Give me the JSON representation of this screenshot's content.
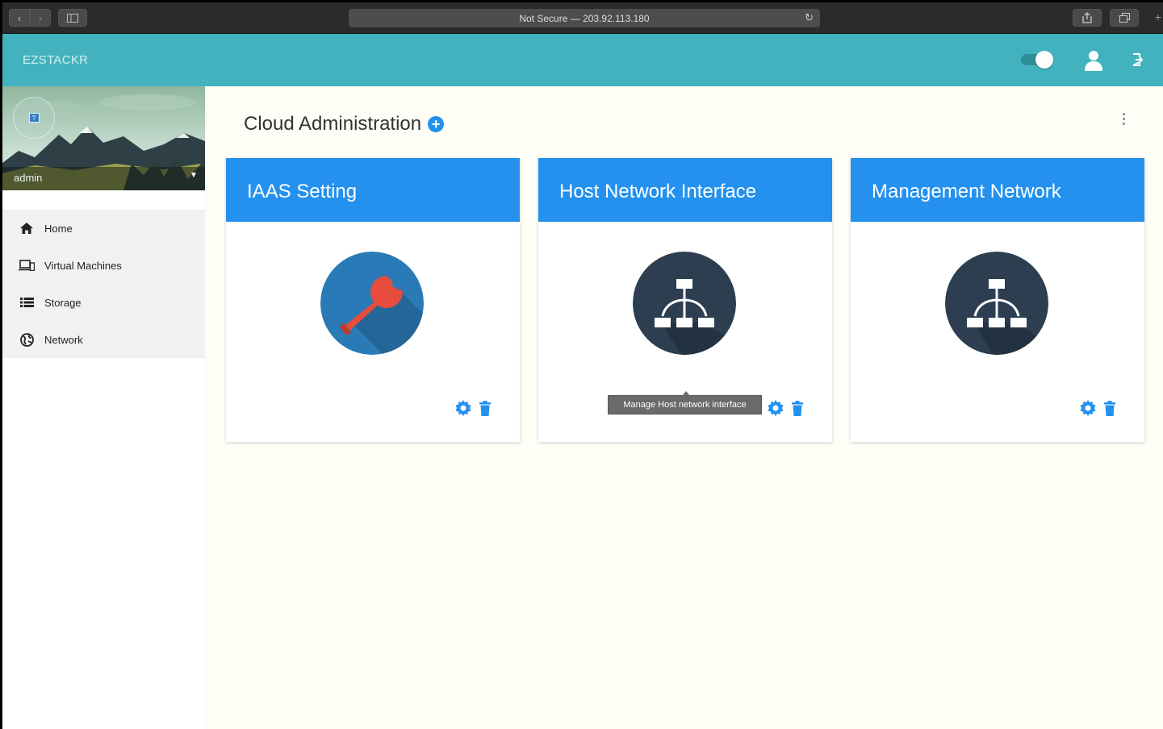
{
  "browser": {
    "url": "Not Secure — 203.92.113.180"
  },
  "app": {
    "brand": "EZSTACKR"
  },
  "sidebar": {
    "username": "admin",
    "items": [
      {
        "label": "Home",
        "icon": "home-icon"
      },
      {
        "label": "Virtual Machines",
        "icon": "devices-icon"
      },
      {
        "label": "Storage",
        "icon": "list-icon"
      },
      {
        "label": "Network",
        "icon": "globe-icon"
      }
    ]
  },
  "main": {
    "title": "Cloud Administration",
    "cards": [
      {
        "title": "IAAS Setting",
        "icon": "wrench-icon"
      },
      {
        "title": "Host Network Interface",
        "icon": "network-icon"
      },
      {
        "title": "Management Network",
        "icon": "network-icon"
      }
    ],
    "tooltip": "Manage Host network interface"
  },
  "colors": {
    "topbar": "#42b3be",
    "card_header": "#2491ee",
    "icon_circle_blue": "#2a7ab8",
    "icon_circle_dark": "#2c3e50",
    "wrench": "#e74c3c"
  }
}
